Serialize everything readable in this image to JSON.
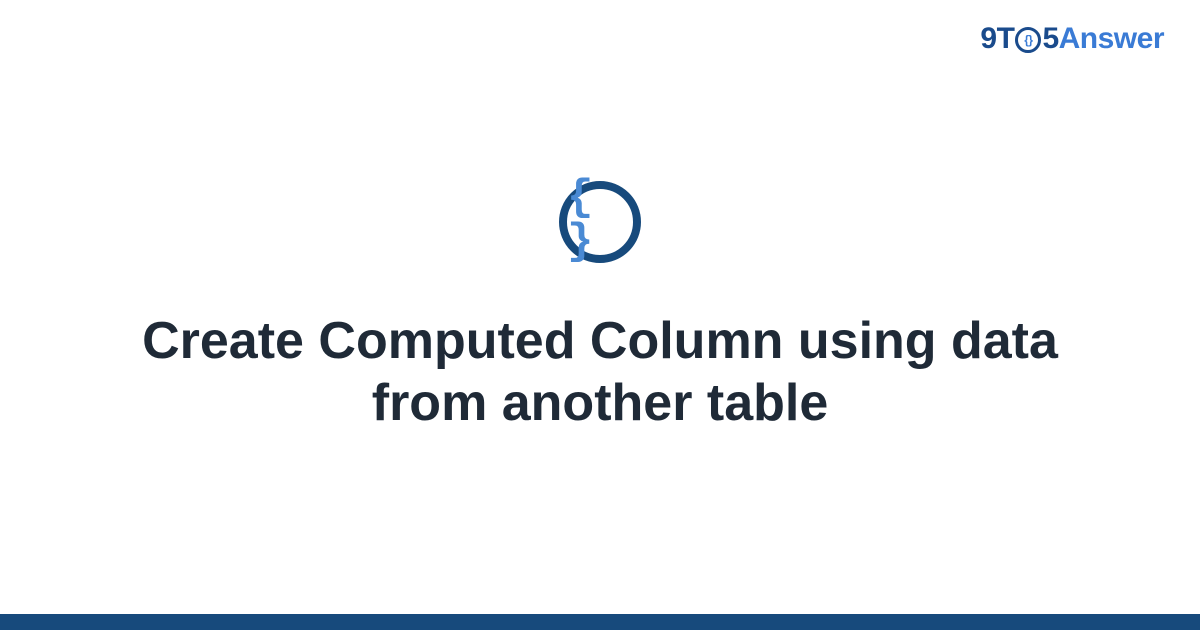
{
  "logo": {
    "part_9t": "9T",
    "part_o_inner": "{}",
    "part_5": "5",
    "part_answer": "Answer"
  },
  "icon": {
    "braces": "{ }"
  },
  "title": "Create Computed Column using data from another table"
}
